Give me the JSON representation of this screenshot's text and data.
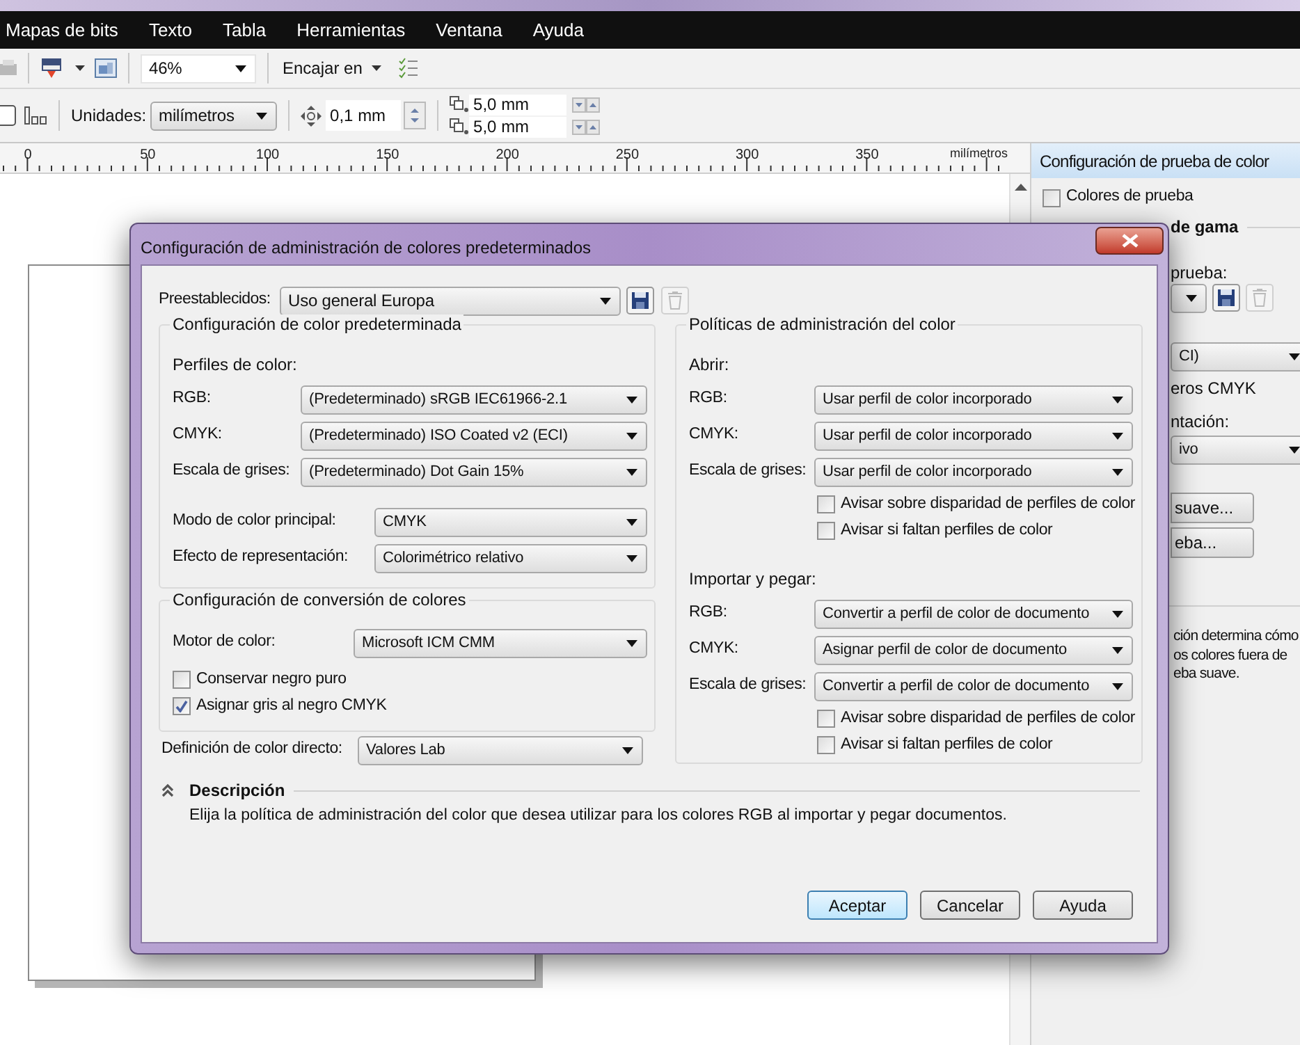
{
  "menu_bar": [
    "Mapas de bits",
    "Texto",
    "Tabla",
    "Herramientas",
    "Ventana",
    "Ayuda"
  ],
  "standard_toolbar": {
    "zoom": "46%",
    "snap": "Encajar en"
  },
  "property_bar": {
    "units_label": "Unidades:",
    "units": "milímetros",
    "nudge": "0,1 mm",
    "duplicate_x": "5,0 mm",
    "duplicate_y": "5,0 mm"
  },
  "ruler": {
    "labels": [
      "0",
      "50",
      "100",
      "150",
      "200",
      "250",
      "300",
      "350"
    ],
    "unit": "milímetros"
  },
  "docker": {
    "title": "Configuración de prueba de color",
    "proof_colors": {
      "label": "Colores de prueba",
      "checked": false
    },
    "section": "de gama",
    "preset_label": "prueba:",
    "profile": "CI)",
    "option": "eros CMYK",
    "intent_label": "ntación:",
    "intent": "ivo",
    "buttons": [
      "suave...",
      "eba..."
    ],
    "description": [
      "ción determina cómo",
      "os colores fuera de",
      "eba suave."
    ]
  },
  "dialog": {
    "title": "Configuración de administración de colores predeterminados",
    "presets": {
      "label": "Preestablecidos:",
      "value": "Uso general Europa"
    },
    "default_settings": {
      "title": "Configuración de color predeterminada",
      "profiles_label": "Perfiles de color:",
      "profiles": [
        {
          "label": "RGB:",
          "value": "(Predeterminado) sRGB IEC61966-2.1"
        },
        {
          "label": "CMYK:",
          "value": "(Predeterminado) ISO Coated v2 (ECI)"
        },
        {
          "label": "Escala de grises:",
          "value": "(Predeterminado) Dot Gain 15%"
        }
      ],
      "modes": [
        {
          "label": "Modo de color principal:",
          "value": "CMYK"
        },
        {
          "label": "Efecto de representación:",
          "value": "Colorimétrico relativo"
        }
      ]
    },
    "conversion": {
      "title": "Configuración de conversión de colores",
      "engine": {
        "label": "Motor de color:",
        "value": "Microsoft ICM CMM"
      },
      "options": [
        {
          "label": "Conservar negro puro",
          "checked": false
        },
        {
          "label": "Asignar gris al negro CMYK",
          "checked": true
        }
      ]
    },
    "spot": {
      "label": "Definición de color directo:",
      "value": "Valores Lab"
    },
    "policies": {
      "title": "Políticas de administración del color",
      "sections": [
        {
          "label": "Abrir:",
          "rows": [
            {
              "label": "RGB:",
              "value": "Usar perfil de color incorporado"
            },
            {
              "label": "CMYK:",
              "value": "Usar perfil de color incorporado"
            },
            {
              "label": "Escala de grises:",
              "value": "Usar perfil de color incorporado"
            }
          ],
          "warnings": [
            {
              "label": "Avisar sobre disparidad de perfiles de color",
              "checked": false
            },
            {
              "label": "Avisar si faltan perfiles de color",
              "checked": false
            }
          ]
        },
        {
          "label": "Importar y pegar:",
          "rows": [
            {
              "label": "RGB:",
              "value": "Convertir a perfil de color de documento"
            },
            {
              "label": "CMYK:",
              "value": "Asignar perfil de color de documento"
            },
            {
              "label": "Escala de grises:",
              "value": "Convertir a perfil de color de documento"
            }
          ],
          "warnings": [
            {
              "label": "Avisar sobre disparidad de perfiles de color",
              "checked": false
            },
            {
              "label": "Avisar si faltan perfiles de color",
              "checked": false
            }
          ]
        }
      ]
    },
    "description": {
      "title": "Descripción",
      "expanded": true,
      "text": "Elija la política de administración del color que desea utilizar para los colores RGB al importar y pegar documentos."
    },
    "buttons": [
      {
        "label": "Aceptar",
        "default": true
      },
      {
        "label": "Cancelar",
        "default": false
      },
      {
        "label": "Ayuda",
        "default": false
      }
    ]
  }
}
